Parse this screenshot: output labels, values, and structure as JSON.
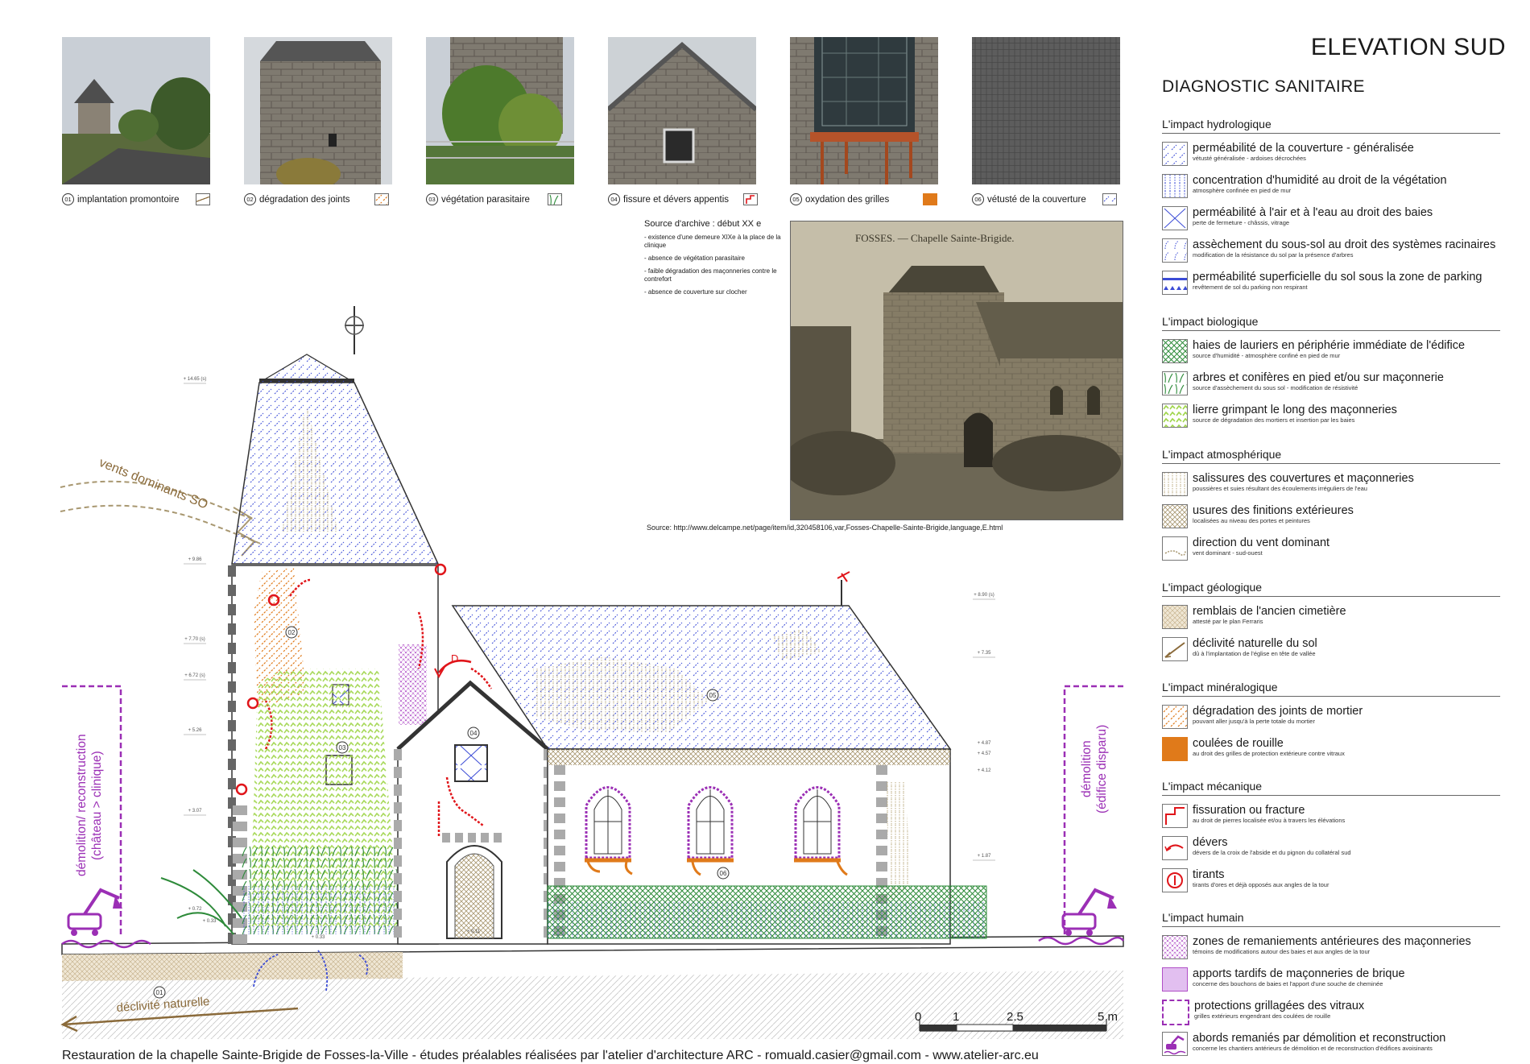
{
  "title": "ELEVATION SUD",
  "subtitle": "DIAGNOSTIC SANITAIRE",
  "photos": [
    {
      "num": "01",
      "caption": "implantation promontoire",
      "swatch": "declivite"
    },
    {
      "num": "02",
      "caption": "dégradation des joints",
      "swatch": "joints"
    },
    {
      "num": "03",
      "caption": "végétation parasitaire",
      "swatch": "arbres"
    },
    {
      "num": "04",
      "caption": "fissure et dévers appentis",
      "swatch": "fissure"
    },
    {
      "num": "05",
      "caption": "oxydation des grilles",
      "swatch": "rouille"
    },
    {
      "num": "06",
      "caption": "vétusté de la couverture",
      "swatch": "couverture"
    }
  ],
  "archive": {
    "heading": "Source d'archive : début XX e",
    "points": [
      "- existence d'une demeure XIXe à la place de la clinique",
      "- absence de végétation parasitaire",
      "- faible dégradation des maçonneries contre le contrefort",
      "- absence de couverture sur clocher"
    ],
    "photo_caption": "FOSSES. — Chapelle Sainte-Brigide.",
    "source": "Source: http://www.delcampe.net/page/item/id,320458106,var,Fosses-Chapelle-Sainte-Brigide,language,E.html"
  },
  "legend": [
    {
      "heading": "L'impact hydrologique",
      "items": [
        {
          "label": "perméabilité de la couverture - généralisée",
          "sub": "vétusté généralisée - ardoises décrochées",
          "swatch": "couverture"
        },
        {
          "label": "concentration d'humidité au droit de la végétation",
          "sub": "atmosphère confinée en pied de mur",
          "swatch": "humidite"
        },
        {
          "label": "perméabilité à l'air et à l'eau au droit des baies",
          "sub": "perte de fermeture - châssis, vitrage",
          "swatch": "baies"
        },
        {
          "label": "assèchement du sous-sol au droit des systèmes racinaires",
          "sub": "modification de la résistance du sol par la présence d'arbres",
          "swatch": "racines"
        },
        {
          "label": "perméabilité superficielle du sol sous la zone de parking",
          "sub": "revêtement de sol du parking non respirant",
          "swatch": "parking"
        }
      ]
    },
    {
      "heading": "L'impact biologique",
      "items": [
        {
          "label": "haies de lauriers en périphérie immédiate de l'édifice",
          "sub": "source d'humidité - atmosphère confiné en pied de mur",
          "swatch": "haies"
        },
        {
          "label": "arbres et conifères en pied et/ou sur maçonnerie",
          "sub": "source d'assèchement du sous sol - modification de résistivité",
          "swatch": "arbres"
        },
        {
          "label": "lierre grimpant le long des maçonneries",
          "sub": "source de dégradation des mortiers et insertion par les baies",
          "swatch": "lierre"
        }
      ]
    },
    {
      "heading": "L'impact atmosphérique",
      "items": [
        {
          "label": "salissures des couvertures et maçonneries",
          "sub": "poussières et suies résultant des écoulements irréguliers de l'eau",
          "swatch": "salissures"
        },
        {
          "label": "usures des finitions extérieures",
          "sub": "localisées au niveau des portes et peintures",
          "swatch": "usures"
        },
        {
          "label": "direction du vent dominant",
          "sub": "vent dominant - sud-ouest",
          "swatch": "vent"
        }
      ]
    },
    {
      "heading": "L'impact géologique",
      "items": [
        {
          "label": "remblais de l'ancien cimetière",
          "sub": "attesté par le plan Ferraris",
          "swatch": "remblais"
        },
        {
          "label": "déclivité naturelle du sol",
          "sub": "dû à l'implantation de l'église en tête de vallée",
          "swatch": "declivite"
        }
      ]
    },
    {
      "heading": "L'impact minéralogique",
      "items": [
        {
          "label": "dégradation des joints de mortier",
          "sub": "pouvant aller jusqu'à la perte totale du mortier",
          "swatch": "joints"
        },
        {
          "label": "coulées de rouille",
          "sub": "au droit des grilles de protection extérieure contre vitraux",
          "swatch": "rouille"
        }
      ]
    },
    {
      "heading": "L'impact mécanique",
      "items": [
        {
          "label": "fissuration ou fracture",
          "sub": "au droit de pierres localisée et/ou à travers les élévations",
          "swatch": "fissure"
        },
        {
          "label": "dévers",
          "sub": "dévers de la croix de l'abside et du pignon du collatéral sud",
          "swatch": "devers"
        },
        {
          "label": "tirants",
          "sub": "tirants d'ores et déjà opposés aux angles de la tour",
          "swatch": "tirants"
        }
      ]
    },
    {
      "heading": "L'impact humain",
      "items": [
        {
          "label": "zones de remaniements antérieures des maçonneries",
          "sub": "témoins de modifications autour des baies et aux angles de la tour",
          "swatch": "remaniements"
        },
        {
          "label": "apports tardifs de maçonneries de brique",
          "sub": "concerne des bouchons de baies et l'apport d'une souche de cheminée",
          "swatch": "brique"
        },
        {
          "label": "protections grillagées des vitraux",
          "sub": "grilles extérieurs engendrant des coulées de rouille",
          "swatch": "grillage"
        },
        {
          "label": "abords remaniés par démolition et reconstruction",
          "sub": "concerne les chantiers antérieurs de démolition et de reconstruction d'édifices avoisinants",
          "swatch": "demolition"
        }
      ]
    }
  ],
  "drawing": {
    "wind_label": "vents dominants SO",
    "slope_label": "déclivité naturelle",
    "left_label": [
      "démolition/ reconstruction",
      "(château > clinique)"
    ],
    "right_label": [
      "démolition",
      "(édifice disparu)"
    ],
    "markers": [
      "01",
      "02",
      "03",
      "04",
      "05",
      "06"
    ],
    "levels": [
      "+ 14.65 (s)",
      "+ 9.86",
      "+ 7.70 (s)",
      "+ 6.72 (s)",
      "+ 5.26",
      "+ 3.07",
      "+ 0.72",
      "+ 0.33",
      "+ 0.33",
      "+ 0.11",
      "+ 8.90 (s)",
      "+ 7.35",
      "+ 4.87",
      "+ 4.57",
      "+ 4.12",
      "+ 1.87"
    ],
    "scale_ticks": [
      "0",
      "1",
      "2.5",
      "5 m"
    ]
  },
  "footer": "Restauration de la chapelle Sainte-Brigide de Fosses-la-Ville - études préalables réalisées par l'atelier d'architecture ARC - romuald.casier@gmail.com - www.atelier-arc.eu",
  "colors": {
    "blue": "#3b4bd6",
    "purple": "#9b2fb5",
    "orange": "#e07a1a",
    "red": "#e0151a",
    "green": "#2e8b3a",
    "lightgreen": "#9fd54a",
    "ground": "#d8cbb0"
  }
}
